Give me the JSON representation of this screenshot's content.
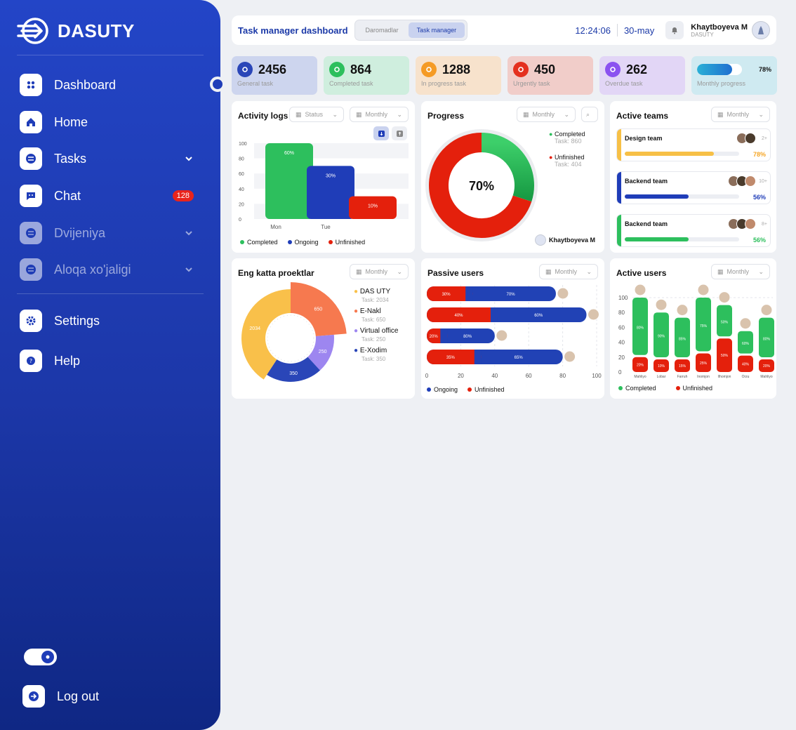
{
  "app": {
    "name": "DASUTY"
  },
  "sidebar": {
    "items": [
      {
        "label": "Dashboard",
        "icon": "grid-icon"
      },
      {
        "label": "Home",
        "icon": "home-icon"
      },
      {
        "label": "Tasks",
        "icon": "tasks-icon"
      },
      {
        "label": "Chat",
        "icon": "chat-icon",
        "badge": "128"
      },
      {
        "label": "Dvijeniya",
        "icon": "dvijeniya-icon"
      },
      {
        "label": "Aloqa xo'jaligi",
        "icon": "aloqa-icon"
      },
      {
        "label": "Settings",
        "icon": "gear-icon"
      },
      {
        "label": "Help",
        "icon": "help-icon"
      }
    ],
    "logout_label": "Log out"
  },
  "header": {
    "title": "Task manager dashboard",
    "tabs": [
      "Daromadlar",
      "Task manager"
    ],
    "active_tab": "Task manager",
    "time": "12:24:06",
    "date": "30-may",
    "user_name": "Khaytboyeva M",
    "user_sub": "DASUTY"
  },
  "kpis": [
    {
      "value": "2456",
      "label": "General task",
      "color": "#2a46b8",
      "bg": "#cdd5ee"
    },
    {
      "value": "864",
      "label": "Completed task",
      "color": "#2dbf5d",
      "bg": "#cfeede"
    },
    {
      "value": "1288",
      "label": "In progress task",
      "color": "#f59b25",
      "bg": "#f7e2cc"
    },
    {
      "value": "450",
      "label": "Urgently task",
      "color": "#e4301f",
      "bg": "#f1cdc9"
    },
    {
      "value": "262",
      "label": "Overdue task",
      "color": "#8b52f0",
      "bg": "#e2d6f6"
    },
    {
      "value": "78%",
      "label": "Monthly progress",
      "color": "#2bb0d6",
      "bg": "#cfeaf1"
    }
  ],
  "activity": {
    "title": "Activity logs",
    "filter1": "Status",
    "filter2": "Monthly",
    "legend": [
      "Completed",
      "Ongoing",
      "Unfinished"
    ]
  },
  "progress": {
    "title": "Progress",
    "filter": "Monthly",
    "center": "70%",
    "completed_label": "Completed",
    "completed_task": "Task: 860",
    "unfinished_label": "Unfinished",
    "unfinished_task": "Task: 404",
    "owner": "Khaytboyeva M"
  },
  "teams": {
    "title": "Active teams",
    "filter": "Monthly",
    "items": [
      {
        "name": "Design team",
        "pct": "78%",
        "value": 0.78,
        "more": "2+",
        "color": "#f7c046",
        "pctcolor": "#f5a524"
      },
      {
        "name": "Backend team",
        "pct": "56%",
        "value": 0.56,
        "more": "10+",
        "color": "#1f3db8",
        "pctcolor": "#1f3db8"
      },
      {
        "name": "Backend team",
        "pct": "56%",
        "value": 0.56,
        "more": "8+",
        "color": "#2dbf5d",
        "pctcolor": "#2dbf5d"
      }
    ]
  },
  "projects": {
    "title": "Eng katta proektlar",
    "filter": "Monthly",
    "items": [
      {
        "name": "DAS UTY",
        "task": "Task: 2034",
        "color": "#f9c04a"
      },
      {
        "name": "E-Nakl",
        "task": "Task: 650",
        "color": "#f6794f"
      },
      {
        "name": "Virtual office",
        "task": "Task: 250",
        "color": "#9d86f0"
      },
      {
        "name": "E-Xodim",
        "task": "Task: 350",
        "color": "#2a46b8"
      }
    ]
  },
  "passive": {
    "title": "Passive users",
    "filter": "Monthly",
    "legend": [
      "Ongoing",
      "Unfinished"
    ]
  },
  "active_users": {
    "title": "Active users",
    "filter": "Monthly",
    "legend": [
      "Completed",
      "Unfinished"
    ]
  },
  "chart_data": [
    {
      "type": "bar",
      "title": "Activity logs",
      "categories": [
        "Mon",
        "Tue"
      ],
      "series": [
        {
          "name": "Completed",
          "values": [
            100
          ]
        },
        {
          "name": "Ongoing",
          "values": [
            70
          ]
        },
        {
          "name": "Unfinished",
          "values": [
            30
          ]
        }
      ],
      "labels": [
        "60%",
        "30%",
        "10%"
      ],
      "ylim": [
        0,
        100
      ],
      "yticks": [
        0,
        20,
        40,
        60,
        80,
        100
      ]
    },
    {
      "type": "pie",
      "title": "Progress",
      "series": [
        {
          "name": "Completed",
          "value": 70
        },
        {
          "name": "Unfinished",
          "value": 30
        }
      ]
    },
    {
      "type": "pie",
      "title": "Eng katta proektlar",
      "series": [
        {
          "name": "DAS UTY",
          "value": 2034
        },
        {
          "name": "E-Nakl",
          "value": 650
        },
        {
          "name": "Virtual office",
          "value": 250
        },
        {
          "name": "E-Xodim",
          "value": 350
        }
      ]
    },
    {
      "type": "bar",
      "title": "Passive users",
      "orientation": "horizontal",
      "rows": [
        {
          "unfinished": 30,
          "ongoing": 70,
          "total": 76
        },
        {
          "unfinished": 40,
          "ongoing": 60,
          "total": 94
        },
        {
          "unfinished": 20,
          "ongoing": 80,
          "total": 40
        },
        {
          "unfinished": 35,
          "ongoing": 65,
          "total": 80
        }
      ],
      "xticks": [
        0,
        20,
        40,
        60,
        80,
        100
      ]
    },
    {
      "type": "bar",
      "title": "Active users",
      "categories": [
        "Mahliyo",
        "Lobar",
        "Farruh",
        "Inomjon",
        "Ilhomjon",
        "Orzu",
        "Mahliyo"
      ],
      "series": [
        {
          "name": "Completed",
          "values": [
            80,
            90,
            85,
            75,
            50,
            60,
            80
          ]
        },
        {
          "name": "Unfinished",
          "values": [
            20,
            10,
            15,
            25,
            50,
            40,
            20
          ]
        }
      ],
      "totals": [
        100,
        80,
        73,
        100,
        90,
        55,
        73
      ],
      "yticks": [
        0,
        20,
        40,
        60,
        80,
        100
      ]
    }
  ]
}
